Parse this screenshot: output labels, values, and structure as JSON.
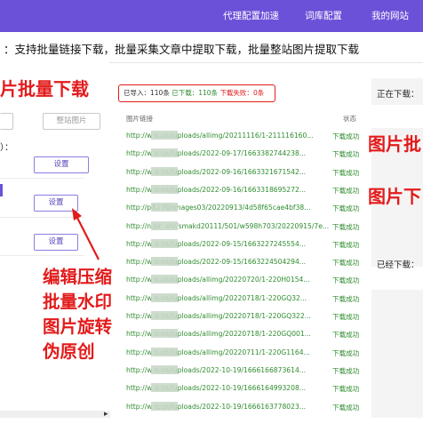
{
  "nav": {
    "items": [
      "代理配置加速",
      "词库配置",
      "我的网站"
    ]
  },
  "headline": "：支持批量链接下载，批量采集文章中提取下载，批量整站图片提取下载",
  "left": {
    "banner": "片批量下载",
    "btn_extract": "整站图片",
    "colon": "）：",
    "settings": [
      "设置",
      "设置",
      "设置"
    ],
    "scroll_right": "▸"
  },
  "stats": {
    "imported_label": "已导入：",
    "imported_value": "110条",
    "downloaded_label": "已下载：",
    "downloaded_value": "110条",
    "failed_label": "下载失败：",
    "failed_value": "0条"
  },
  "table": {
    "col_link": "图片链接",
    "col_status": "状态",
    "rows": [
      {
        "url": "http://w          o.cn//uploads/allimg/20211116/1-211116160...",
        "status": "下载成功"
      },
      {
        "url": "http://w          o.cn//uploads/2022-09-17/1663382744238...",
        "status": "下载成功"
      },
      {
        "url": "http://w          o.cn//uploads/2022-09-16/1663321671542...",
        "status": "下载成功"
      },
      {
        "url": "http://w          o.cn//uploads/2022-09-16/1663318695272...",
        "status": "下载成功"
      },
      {
        "url": "http://p3.i          70/images03/20220913/4d58f65cae4bf38...",
        "status": "下载成功"
      },
      {
        "url": "http://n.sir          .cn//smakd20111/501/w598h703/20220915/7e...",
        "status": "下载成功"
      },
      {
        "url": "http://w          o.cn//uploads/2022-09-15/1663227245554...",
        "status": "下载成功"
      },
      {
        "url": "http://w          o.cn//uploads/2022-09-15/1663224504294...",
        "status": "下载成功"
      },
      {
        "url": "http://w          o.cn//uploads/allimg/20220720/1-220H0154...",
        "status": "下载成功"
      },
      {
        "url": "http://w          o.cn//uploads/allimg/20220718/1-220GQ32...",
        "status": "下载成功"
      },
      {
        "url": "http://w          o.cn//uploads/allimg/20220718/1-220GQ322...",
        "status": "下载成功"
      },
      {
        "url": "http://w          o.cn//uploads/allimg/20220718/1-220GQ001...",
        "status": "下载成功"
      },
      {
        "url": "http://w          o.cn//uploads/allimg/20220711/1-220G1164...",
        "status": "下载成功"
      },
      {
        "url": "http://w          o.cn//uploads/2022-10-19/1666166873614...",
        "status": "下载成功"
      },
      {
        "url": "http://w          o.cn//uploads/2022-10-19/1666164993208...",
        "status": "下载成功"
      },
      {
        "url": "http://w          o.cn//uploads/2022-10-19/1666163778023...",
        "status": "下载成功"
      }
    ]
  },
  "right": {
    "downloading_label": "正在下载：",
    "downloaded_label": "已经下载：",
    "promo1": "图片批",
    "promo2": "图片下"
  },
  "annotation": "编辑压缩\n批量水印\n图片旋转\n伪原创",
  "colors": {
    "accent": "#6b50d8",
    "red": "#e31b1b",
    "green": "#2f8c2f"
  }
}
